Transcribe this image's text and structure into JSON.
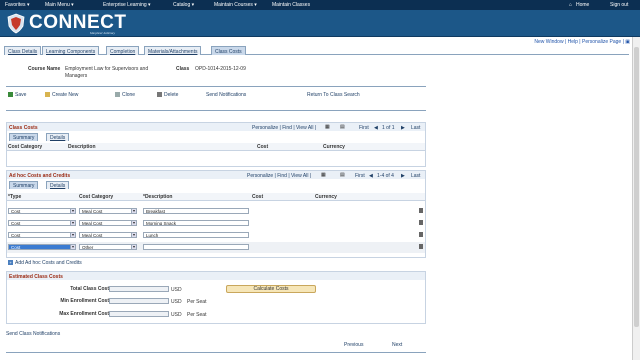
{
  "topnav": {
    "favorites": "Favorites ▾",
    "main_menu": "Main Menu ▾",
    "enterprise": "Enterprise Learning ▾",
    "catalog": "Catalog ▾",
    "maintain_courses": "Maintain Courses ▾",
    "maintain_classes": "Maintain Classes",
    "home": "Home",
    "signout": "Sign out"
  },
  "header": {
    "logo": "CONNECT",
    "sub": "Maryland Judiciary"
  },
  "utils": {
    "text": "New Window | Help | Personalize Page | "
  },
  "tabs": [
    "Class Details",
    "Learning Components",
    "Completion",
    "Materials/Attachments",
    "Class Costs"
  ],
  "course": {
    "name_label": "Course Name",
    "name_value": "Employment Law for Supervisors and Managers",
    "class_label": "Class",
    "class_value": "OPD-1014-2015-12-09"
  },
  "actions": {
    "save": "Save",
    "create": "Create New",
    "clone": "Clone",
    "delete": "Delete",
    "send": "Send Notifications",
    "return": "Return To Class Search"
  },
  "class_costs": {
    "title": "Class Costs",
    "tools": "Personalize | Find | View All |",
    "first": "First",
    "count": "1 of 1",
    "last": "Last",
    "tab_summary": "Summary",
    "tab_details": "Details",
    "cols": [
      "Cost Category",
      "Description",
      "Cost",
      "Currency"
    ]
  },
  "adhoc": {
    "title": "Ad hoc Costs and Credits",
    "tools": "Personalize | Find | View All |",
    "first": "First",
    "count": "1-4 of 4",
    "last": "Last",
    "tab_summary": "Summary",
    "tab_details": "Details",
    "cols": [
      "*Type",
      "Cost Category",
      "*Description",
      "Cost",
      "Currency"
    ],
    "rows": [
      {
        "type": "Cost",
        "category": "Meal Cost",
        "desc": "Breakfast"
      },
      {
        "type": "Cost",
        "category": "Meal Cost",
        "desc": "Morning Snack"
      },
      {
        "type": "Cost",
        "category": "Meal Cost",
        "desc": "Lunch"
      },
      {
        "type": "Cost",
        "category": "Other",
        "desc": ""
      }
    ],
    "add": "Add Ad hoc Costs and Credits"
  },
  "estimated": {
    "title": "Estimated Class Costs",
    "total": "Total Class Cost",
    "min": "Min Enrollment Cost",
    "max": "Max Enrollment Cost",
    "usd": "USD",
    "per_seat": "Per Seat",
    "calc": "Calculate Costs"
  },
  "footer": {
    "send": "Send Class Notifications",
    "previous": "Previous",
    "next": "Next"
  }
}
